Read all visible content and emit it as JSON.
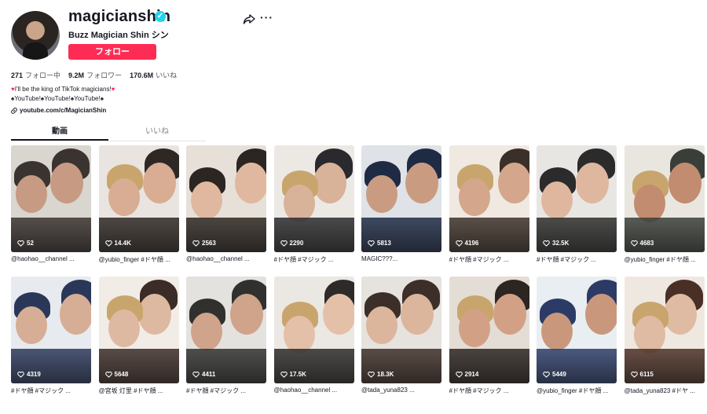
{
  "profile": {
    "username": "magicianshin",
    "nickname": "Buzz Magician Shin シン",
    "follow_label": "フォロー",
    "stats": [
      {
        "value": "271",
        "label": "フォロー中"
      },
      {
        "value": "9.2M",
        "label": "フォロワー"
      },
      {
        "value": "170.6M",
        "label": "いいね"
      }
    ],
    "bio_line1": "I'll be the king of TikTok magicians!",
    "bio_line2": "♠YouTube!♠YouTube!♠YouTube!♠",
    "link": "youtube.com/c/MagicianShin"
  },
  "tabs": [
    {
      "label": "動画",
      "active": true
    },
    {
      "label": "いいね",
      "active": false
    }
  ],
  "colors": {
    "accent": "#fe2c55",
    "verified": "#20d5ec"
  },
  "videos": [
    {
      "views": "52",
      "caption": "@haohao__channel ..."
    },
    {
      "views": "14.4K",
      "caption": "@yubio_finger #ドヤ顔 ..."
    },
    {
      "views": "2563",
      "caption": "@haohao__channel ..."
    },
    {
      "views": "2290",
      "caption": "#ドヤ顔 #マジック ..."
    },
    {
      "views": "5813",
      "caption": "MAGIC???..."
    },
    {
      "views": "4196",
      "caption": "#ドヤ顔 #マジック ..."
    },
    {
      "views": "32.5K",
      "caption": "#ドヤ顔 #マジック ..."
    },
    {
      "views": "4683",
      "caption": "@yubio_finger #ドヤ顔 ..."
    },
    {
      "views": "4319",
      "caption": "#ドヤ顔 #マジック ..."
    },
    {
      "views": "5648",
      "caption": "@宮坂 灯里 #ドヤ顔 ..."
    },
    {
      "views": "4411",
      "caption": "#ドヤ顔 #マジック ..."
    },
    {
      "views": "17.5K",
      "caption": "@haohao__channel ..."
    },
    {
      "views": "18.3K",
      "caption": "@tada_yuna823 ..."
    },
    {
      "views": "2914",
      "caption": "#ドヤ顔 #マジック ..."
    },
    {
      "views": "5449",
      "caption": "@yubio_finger #ドヤ顔 ..."
    },
    {
      "views": "6115",
      "caption": "@tada_yuna823 #ドヤ ..."
    }
  ]
}
